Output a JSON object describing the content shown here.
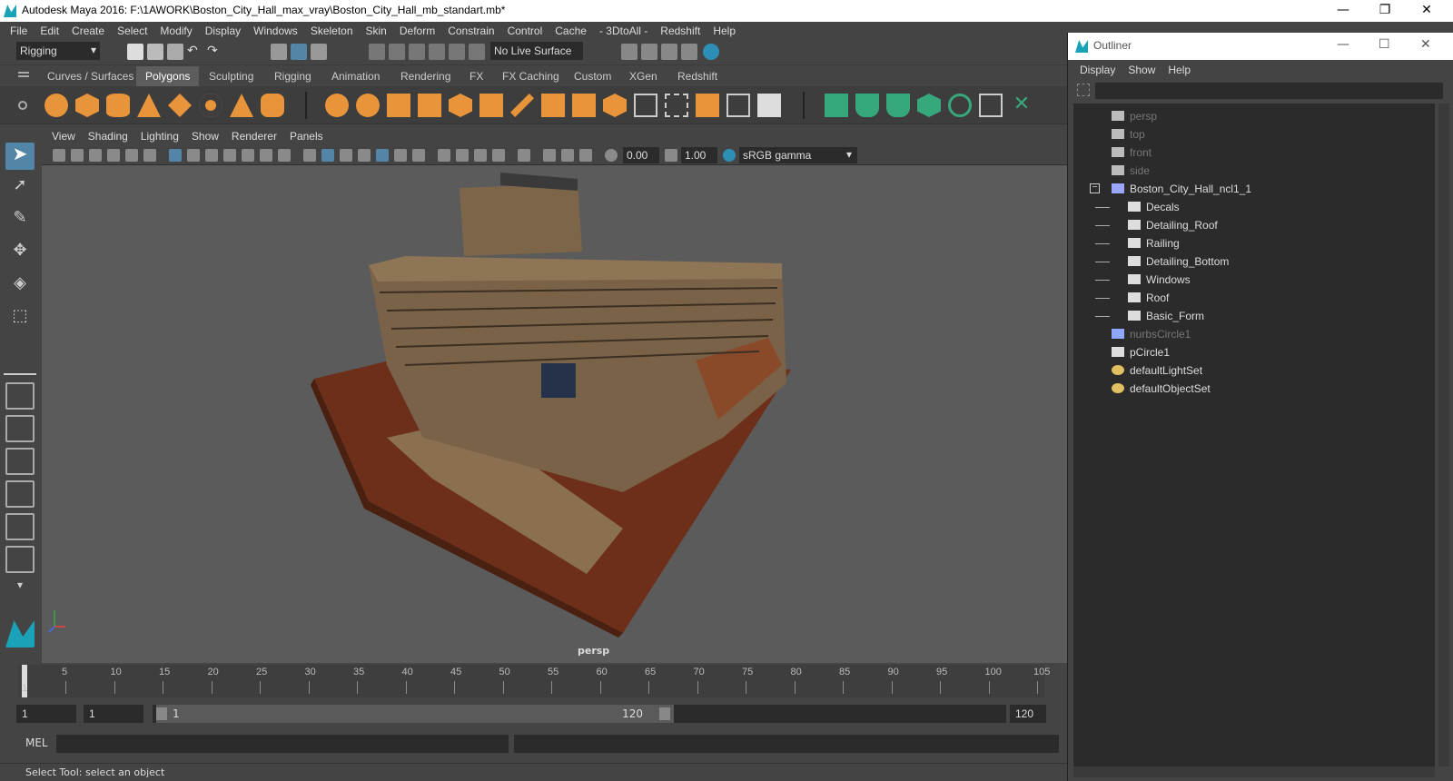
{
  "window": {
    "title": "Autodesk Maya 2016: F:\\1AWORK\\Boston_City_Hall_max_vray\\Boston_City_Hall_mb_standart.mb*",
    "minimize": "—",
    "restore": "❐",
    "close": "✕"
  },
  "menubar": [
    "File",
    "Edit",
    "Create",
    "Select",
    "Modify",
    "Display",
    "Windows",
    "Skeleton",
    "Skin",
    "Deform",
    "Constrain",
    "Control",
    "Cache",
    "- 3DtoAll -",
    "Redshift",
    "Help"
  ],
  "statusline": {
    "mode": "Rigging",
    "live_surface": "No Live Surface"
  },
  "shelf_tabs": [
    "Curves / Surfaces",
    "Polygons",
    "Sculpting",
    "Rigging",
    "Animation",
    "Rendering",
    "FX",
    "FX Caching",
    "Custom",
    "XGen",
    "Redshift"
  ],
  "active_shelf_tab": "Polygons",
  "viewport": {
    "menu": [
      "View",
      "Shading",
      "Lighting",
      "Show",
      "Renderer",
      "Panels"
    ],
    "exposure": "0.00",
    "gamma": "1.00",
    "color_space": "sRGB gamma",
    "camera_label": "persp"
  },
  "timeline": {
    "ticks": [
      "5",
      "10",
      "15",
      "20",
      "25",
      "30",
      "35",
      "40",
      "45",
      "50",
      "55",
      "60",
      "65",
      "70",
      "75",
      "80",
      "85",
      "90",
      "95",
      "100",
      "105"
    ],
    "current_frame_marker": "1"
  },
  "range": {
    "start": "1",
    "anim_start": "1",
    "slider_start": "1",
    "slider_end": "120",
    "end": "120"
  },
  "mel": {
    "label": "MEL"
  },
  "status": {
    "text": "Select Tool: select an object"
  },
  "outliner": {
    "title": "Outliner",
    "menu": [
      "Display",
      "Show",
      "Help"
    ],
    "items": [
      {
        "label": "persp",
        "dim": true,
        "icon": "camera-icon"
      },
      {
        "label": "top",
        "dim": true,
        "icon": "camera-icon"
      },
      {
        "label": "front",
        "dim": true,
        "icon": "camera-icon"
      },
      {
        "label": "side",
        "dim": true,
        "icon": "camera-icon"
      },
      {
        "label": "Boston_City_Hall_ncl1_1",
        "dim": false,
        "icon": "group-icon"
      },
      {
        "label": "Decals",
        "dim": false,
        "icon": "mesh-icon"
      },
      {
        "label": "Detailing_Roof",
        "dim": false,
        "icon": "mesh-icon"
      },
      {
        "label": "Railing",
        "dim": false,
        "icon": "mesh-icon"
      },
      {
        "label": "Detailing_Bottom",
        "dim": false,
        "icon": "mesh-icon"
      },
      {
        "label": "Windows",
        "dim": false,
        "icon": "mesh-icon"
      },
      {
        "label": "Roof",
        "dim": false,
        "icon": "mesh-icon"
      },
      {
        "label": "Basic_Form",
        "dim": false,
        "icon": "mesh-icon"
      },
      {
        "label": "nurbsCircle1",
        "dim": true,
        "icon": "curve-icon"
      },
      {
        "label": "pCircle1",
        "dim": false,
        "icon": "mesh-icon"
      },
      {
        "label": "defaultLightSet",
        "dim": false,
        "icon": "set-icon"
      },
      {
        "label": "defaultObjectSet",
        "dim": false,
        "icon": "set-icon"
      }
    ]
  },
  "colors": {
    "panel": "#444444",
    "field": "#2b2b2b",
    "viewport_bg": "#5b5b5b",
    "accent": "#5285a6",
    "shelf_icon": "#e8943a",
    "shelf_icon_green": "#37a87c"
  }
}
